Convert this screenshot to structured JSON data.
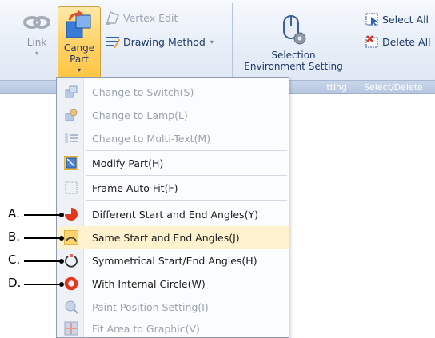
{
  "ribbon": {
    "link": {
      "label": "Link"
    },
    "cange_part": {
      "line1": "Cange",
      "line2": "Part"
    },
    "vertex_edit": {
      "label": "Vertex Edit"
    },
    "drawing_method": {
      "label": "Drawing Method"
    },
    "selection_env": {
      "line1": "Selection",
      "line2": "Environment Setting"
    },
    "select_all": {
      "label": "Select All"
    },
    "delete_all": {
      "label": "Delete All"
    },
    "groups": {
      "setting_label": "tting",
      "select_delete_label": "Select/Delete"
    }
  },
  "menu": {
    "items": [
      {
        "label": "Change to Switch(S)",
        "enabled": false
      },
      {
        "label": "Change to Lamp(L)",
        "enabled": false
      },
      {
        "label": "Change to Multi-Text(M)",
        "enabled": false
      },
      {
        "label": "Modify Part(H)",
        "enabled": true
      },
      {
        "label": "Frame Auto Fit(F)",
        "enabled": true
      },
      {
        "label": "Different Start and End Angles(Y)",
        "enabled": true
      },
      {
        "label": "Same Start and End Angles(J)",
        "enabled": true
      },
      {
        "label": "Symmetrical Start/End Angles(H)",
        "enabled": true
      },
      {
        "label": "With Internal Circle(W)",
        "enabled": true
      },
      {
        "label": "Paint Position Setting(I)",
        "enabled": false
      },
      {
        "label": "Fit Area to Graphic(V)",
        "enabled": false
      }
    ]
  },
  "callouts": [
    "A.",
    "B.",
    "C.",
    "D."
  ],
  "colors": {
    "highlight": "#ffc33d",
    "pie_red": "#e4361b",
    "accent_blue": "#1e3966"
  }
}
